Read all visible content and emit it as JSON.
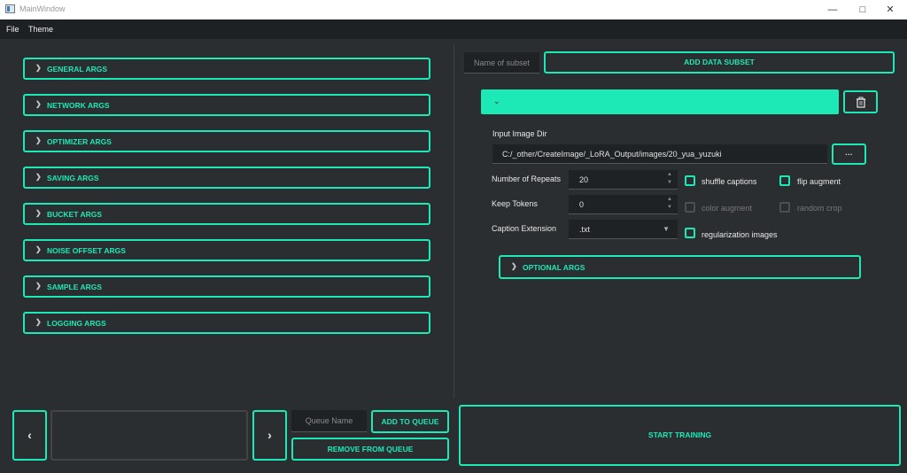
{
  "window": {
    "title": "MainWindow"
  },
  "menu": {
    "items": [
      "File",
      "Theme"
    ]
  },
  "args_sections": [
    "GENERAL ARGS",
    "NETWORK ARGS",
    "OPTIMIZER ARGS",
    "SAVING ARGS",
    "BUCKET ARGS",
    "NOISE OFFSET ARGS",
    "SAMPLE ARGS",
    "LOGGING ARGS"
  ],
  "subset": {
    "name_placeholder": "Name of subset",
    "add_button": "ADD DATA SUBSET",
    "input_image_dir_label": "Input Image Dir",
    "input_image_dir_value": "C:/_other/CreateImage/_LoRA_Output/images/20_yua_yuzuki",
    "browse_label": "···",
    "num_repeats_label": "Number of Repeats",
    "num_repeats_value": "20",
    "keep_tokens_label": "Keep Tokens",
    "keep_tokens_value": "0",
    "caption_ext_label": "Caption Extension",
    "caption_ext_value": ".txt",
    "shuffle_captions_label": "shuffle captions",
    "flip_augment_label": "flip augment",
    "color_augment_label": "color augment",
    "random_crop_label": "random crop",
    "regularization_label": "regularization images",
    "optional_args_label": "OPTIONAL ARGS"
  },
  "queue": {
    "prev_label": "‹",
    "next_label": "›",
    "name_placeholder": "Queue Name",
    "add_label": "ADD TO QUEUE",
    "remove_label": "REMOVE FROM QUEUE"
  },
  "start_training_label": "START TRAINING",
  "colors": {
    "accent": "#1de9b6",
    "background": "#2b2e31",
    "menubar": "#1e2124"
  },
  "icons": {
    "trash": "trash-icon",
    "chevron": "chevron-right-icon"
  }
}
